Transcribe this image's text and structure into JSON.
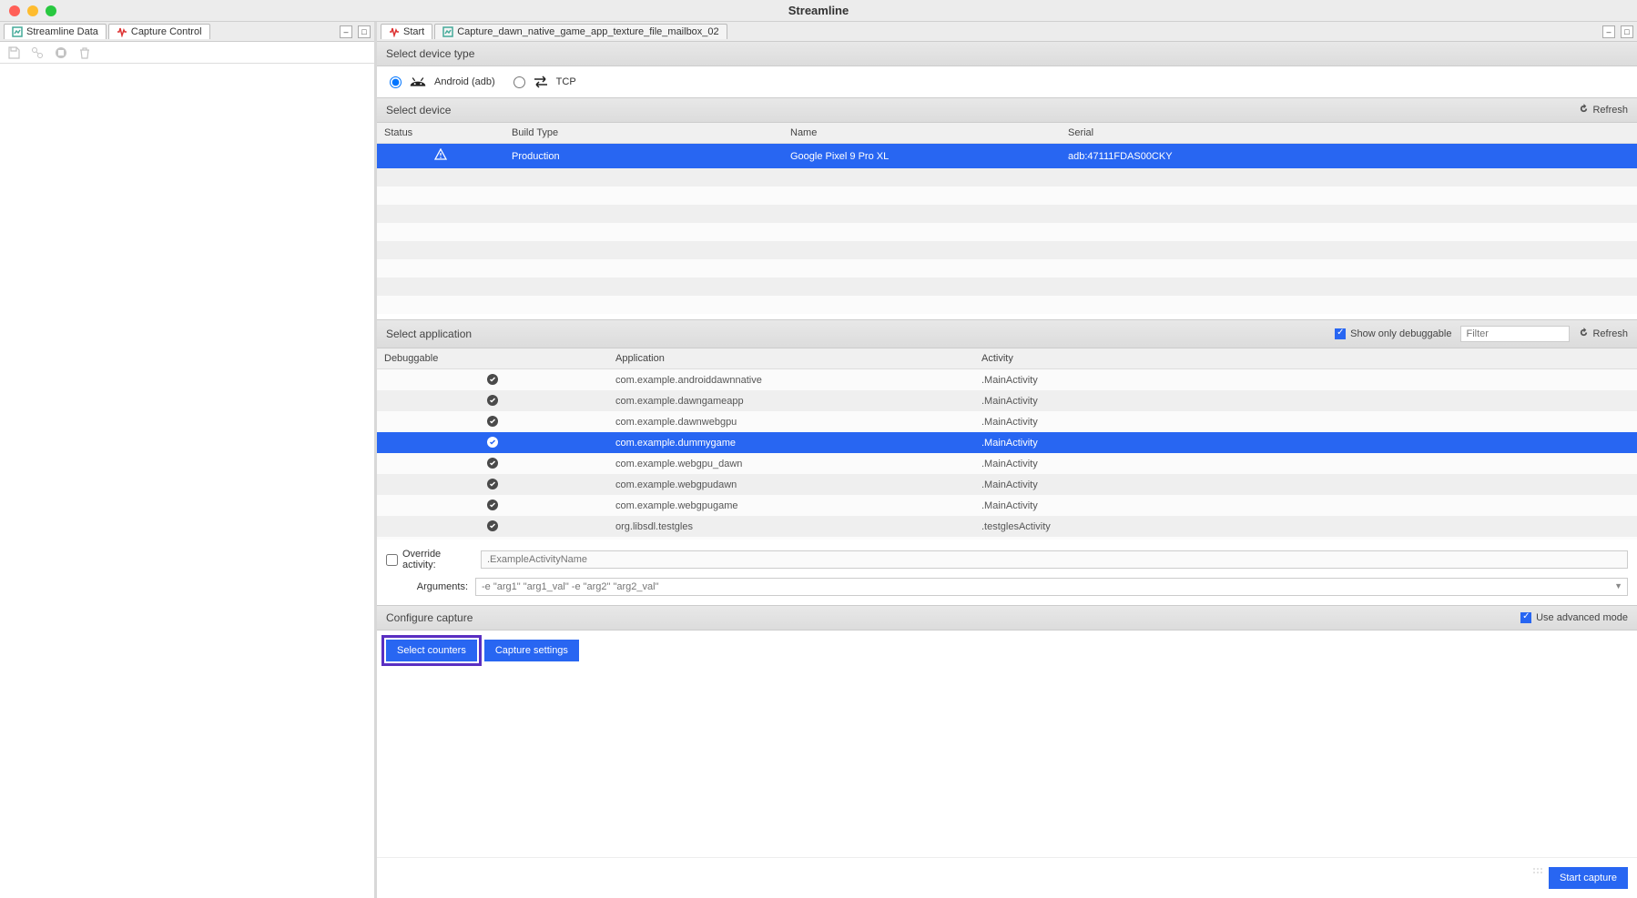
{
  "window": {
    "title": "Streamline"
  },
  "left_panel": {
    "tabs": [
      {
        "label": "Streamline Data"
      },
      {
        "label": "Capture Control"
      }
    ]
  },
  "right_panel": {
    "tabs": [
      {
        "label": "Start"
      },
      {
        "label": "Capture_dawn_native_game_app_texture_file_mailbox_02"
      }
    ]
  },
  "sections": {
    "device_type": {
      "title": "Select device type"
    },
    "device": {
      "title": "Select device",
      "refresh": "Refresh"
    },
    "application": {
      "title": "Select application",
      "show_debuggable": "Show only debuggable",
      "filter_placeholder": "Filter",
      "refresh": "Refresh"
    },
    "configure": {
      "title": "Configure capture",
      "advanced": "Use advanced mode"
    }
  },
  "device_type_options": {
    "android": "Android (adb)",
    "tcp": "TCP"
  },
  "device_table": {
    "headers": {
      "status": "Status",
      "build_type": "Build Type",
      "name": "Name",
      "serial": "Serial"
    },
    "rows": [
      {
        "status": "warn",
        "build_type": "Production",
        "name": "Google Pixel 9 Pro XL",
        "serial": "adb:47111FDAS00CKY",
        "selected": true
      }
    ]
  },
  "app_table": {
    "headers": {
      "debuggable": "Debuggable",
      "application": "Application",
      "activity": "Activity"
    },
    "rows": [
      {
        "debuggable": true,
        "application": "com.example.androiddawnnative",
        "activity": ".MainActivity",
        "selected": false
      },
      {
        "debuggable": true,
        "application": "com.example.dawngameapp",
        "activity": ".MainActivity",
        "selected": false
      },
      {
        "debuggable": true,
        "application": "com.example.dawnwebgpu",
        "activity": ".MainActivity",
        "selected": false
      },
      {
        "debuggable": true,
        "application": "com.example.dummygame",
        "activity": ".MainActivity",
        "selected": true
      },
      {
        "debuggable": true,
        "application": "com.example.webgpu_dawn",
        "activity": ".MainActivity",
        "selected": false
      },
      {
        "debuggable": true,
        "application": "com.example.webgpudawn",
        "activity": ".MainActivity",
        "selected": false
      },
      {
        "debuggable": true,
        "application": "com.example.webgpugame",
        "activity": ".MainActivity",
        "selected": false
      },
      {
        "debuggable": true,
        "application": "org.libsdl.testgles",
        "activity": ".testglesActivity",
        "selected": false
      }
    ]
  },
  "form": {
    "override_label": "Override activity:",
    "override_placeholder": ".ExampleActivityName",
    "arguments_label": "Arguments:",
    "arguments_placeholder": "-e \"arg1\" \"arg1_val\" -e \"arg2\" \"arg2_val\""
  },
  "buttons": {
    "select_counters": "Select counters",
    "capture_settings": "Capture settings",
    "start_capture": "Start capture"
  }
}
